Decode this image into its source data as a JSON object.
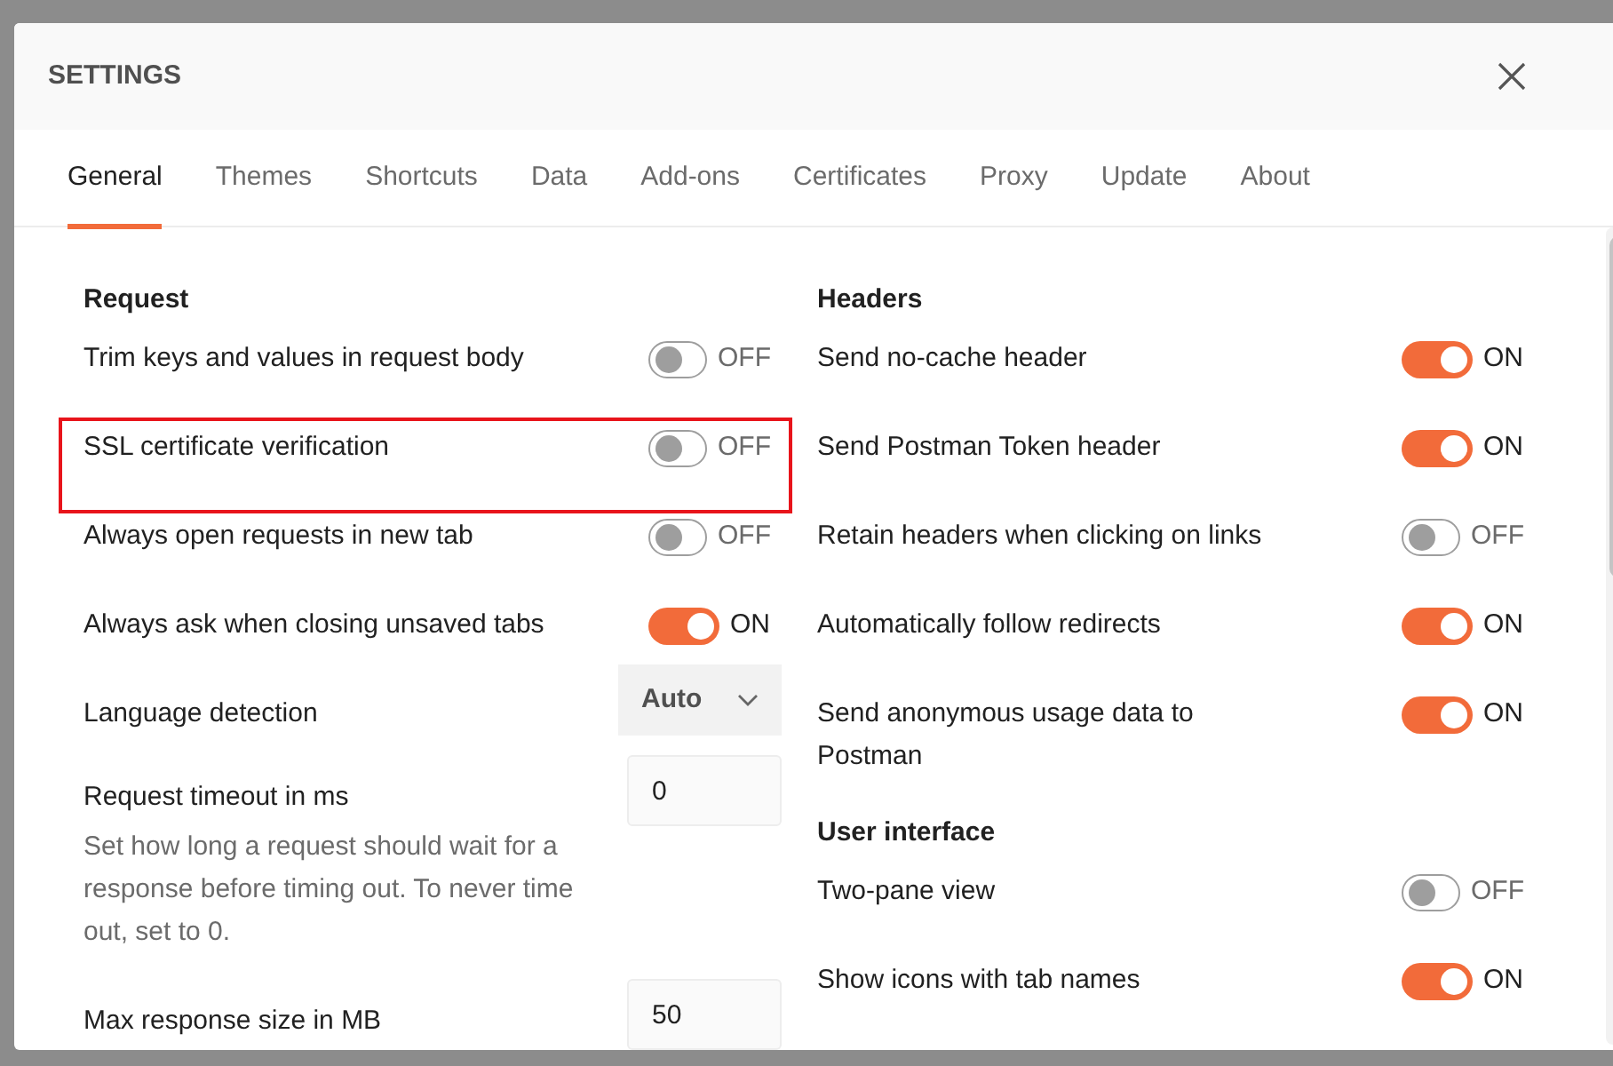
{
  "dialog": {
    "title": "SETTINGS"
  },
  "tabs": [
    {
      "label": "General",
      "selected": true
    },
    {
      "label": "Themes",
      "selected": false
    },
    {
      "label": "Shortcuts",
      "selected": false
    },
    {
      "label": "Data",
      "selected": false
    },
    {
      "label": "Add-ons",
      "selected": false
    },
    {
      "label": "Certificates",
      "selected": false
    },
    {
      "label": "Proxy",
      "selected": false
    },
    {
      "label": "Update",
      "selected": false
    },
    {
      "label": "About",
      "selected": false
    }
  ],
  "columns": [
    {
      "sections": [
        {
          "heading": "Request",
          "items": [
            {
              "kind": "toggle",
              "label": "Trim keys and values in request body",
              "on": false,
              "state_text": "OFF",
              "highlighted": false
            },
            {
              "kind": "toggle",
              "label": "SSL certificate verification",
              "on": false,
              "state_text": "OFF",
              "highlighted": true
            },
            {
              "kind": "toggle",
              "label": "Always open requests in new tab",
              "on": false,
              "state_text": "OFF",
              "highlighted": false
            },
            {
              "kind": "toggle",
              "label": "Always ask when closing unsaved tabs",
              "on": true,
              "state_text": "ON",
              "highlighted": false
            },
            {
              "kind": "select",
              "label": "Language detection",
              "value": "Auto"
            },
            {
              "kind": "number",
              "label": "Request timeout in ms",
              "value": "0",
              "description": "Set how long a request should wait for a response before timing out. To never time out, set to 0."
            },
            {
              "kind": "number",
              "label": "Max response size in MB",
              "value": "50"
            }
          ]
        }
      ]
    },
    {
      "sections": [
        {
          "heading": "Headers",
          "items": [
            {
              "kind": "toggle",
              "label": "Send no-cache header",
              "on": true,
              "state_text": "ON",
              "highlighted": false
            },
            {
              "kind": "toggle",
              "label": "Send Postman Token header",
              "on": true,
              "state_text": "ON",
              "highlighted": false
            },
            {
              "kind": "toggle",
              "label": "Retain headers when clicking on links",
              "on": false,
              "state_text": "OFF",
              "highlighted": false
            },
            {
              "kind": "toggle",
              "label": "Automatically follow redirects",
              "on": true,
              "state_text": "ON",
              "highlighted": false
            },
            {
              "kind": "toggle",
              "label": "Send anonymous usage data to Postman",
              "on": true,
              "state_text": "ON",
              "highlighted": false
            }
          ]
        },
        {
          "heading": "User interface",
          "items": [
            {
              "kind": "toggle",
              "label": "Two-pane view",
              "on": false,
              "state_text": "OFF",
              "highlighted": false
            },
            {
              "kind": "toggle",
              "label": "Show icons with tab names",
              "on": true,
              "state_text": "ON",
              "highlighted": false
            }
          ]
        }
      ]
    }
  ]
}
